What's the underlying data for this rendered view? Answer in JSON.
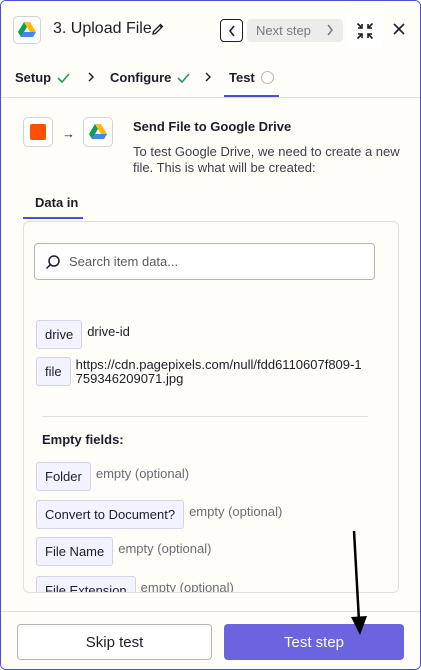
{
  "header": {
    "title": "3. Upload File",
    "next_step_label": "Next step"
  },
  "tabs": [
    {
      "label": "Setup",
      "status": "complete"
    },
    {
      "label": "Configure",
      "status": "complete"
    },
    {
      "label": "Test",
      "status": "active"
    }
  ],
  "intro": {
    "title": "Send File to Google Drive",
    "description": "To test Google Drive, we need to create a new file. This is what will be created:"
  },
  "data_in": {
    "tab_label": "Data in",
    "search_placeholder": "Search item data...",
    "fields": [
      {
        "key": "drive",
        "value": "drive-id"
      },
      {
        "key": "file",
        "value": "https://cdn.pagepixels.com/null/fdd6110607f809-1759346209071.jpg"
      }
    ],
    "empty_heading": "Empty fields:",
    "empty_fields": [
      {
        "key": "Folder",
        "value": "empty (optional)"
      },
      {
        "key": "Convert to Document?",
        "value": "empty (optional)"
      },
      {
        "key": "File Name",
        "value": "empty (optional)"
      },
      {
        "key": "File Extension",
        "value": "empty (optional)"
      }
    ]
  },
  "footer": {
    "skip_label": "Skip test",
    "test_label": "Test step"
  },
  "colors": {
    "accent": "#4b4fd6",
    "primary_button": "#6b63e0",
    "source_app": "#ff4f00",
    "check": "#1f9d55"
  }
}
